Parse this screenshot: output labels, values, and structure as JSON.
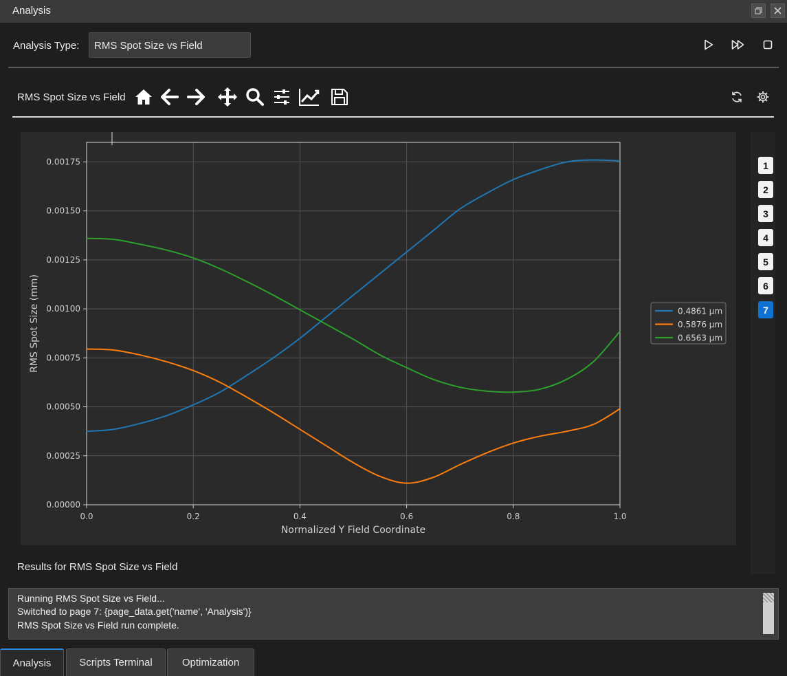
{
  "window": {
    "title": "Analysis"
  },
  "analysis_type": {
    "label": "Analysis Type:",
    "value": "RMS Spot Size vs Field"
  },
  "toolbar": {
    "plot_title": "RMS Spot Size vs Field",
    "icons": [
      "home-icon",
      "back-arrow-icon",
      "forward-arrow-icon",
      "pan-icon",
      "zoom-icon",
      "configure-subplots-icon",
      "edit-axes-icon",
      "save-icon"
    ],
    "right_icons": [
      "refresh-icon",
      "gear-icon"
    ]
  },
  "run_controls": [
    "play-icon",
    "fast-forward-icon",
    "stop-icon"
  ],
  "pages": {
    "items": [
      "1",
      "2",
      "3",
      "4",
      "5",
      "6",
      "7"
    ],
    "active": "7"
  },
  "results_label": "Results for RMS Spot Size vs Field",
  "console": {
    "lines": [
      "Running RMS Spot Size vs Field...",
      "Switched to page 7: {page_data.get('name', 'Analysis')}",
      "RMS Spot Size vs Field run complete."
    ]
  },
  "tabs": [
    {
      "label": "Analysis",
      "active": true
    },
    {
      "label": "Scripts Terminal",
      "active": false
    },
    {
      "label": "Optimization",
      "active": false
    }
  ],
  "chart_data": {
    "type": "line",
    "title": "",
    "xlabel": "Normalized Y Field Coordinate",
    "ylabel": "RMS Spot Size (mm)",
    "xlim": [
      0,
      1
    ],
    "ylim": [
      0,
      0.00185
    ],
    "xticks": [
      "0.0",
      "0.2",
      "0.4",
      "0.6",
      "0.8",
      "1.0"
    ],
    "yticks": [
      "0.00000",
      "0.00025",
      "0.00050",
      "0.00075",
      "0.00100",
      "0.00125",
      "0.00150",
      "0.00175"
    ],
    "grid": true,
    "legend_position": "center-right",
    "x": [
      0,
      0.05,
      0.1,
      0.15,
      0.2,
      0.25,
      0.3,
      0.35,
      0.4,
      0.45,
      0.5,
      0.55,
      0.6,
      0.65,
      0.7,
      0.75,
      0.8,
      0.85,
      0.9,
      0.95,
      1.0
    ],
    "series": [
      {
        "name": "0.4861 µm",
        "color": "#1f77b4",
        "values": [
          0.000375,
          0.000385,
          0.000415,
          0.000455,
          0.00051,
          0.000575,
          0.00066,
          0.00075,
          0.00085,
          0.00096,
          0.00107,
          0.00118,
          0.00129,
          0.0014,
          0.00151,
          0.00159,
          0.00166,
          0.00171,
          0.00175,
          0.00176,
          0.001755
        ]
      },
      {
        "name": "0.5876 µm",
        "color": "#ff7f0e",
        "values": [
          0.000795,
          0.00079,
          0.000765,
          0.00073,
          0.000685,
          0.000625,
          0.00055,
          0.00047,
          0.000385,
          0.0003,
          0.000215,
          0.000145,
          0.00011,
          0.00014,
          0.000205,
          0.000265,
          0.000315,
          0.00035,
          0.000375,
          0.00041,
          0.00049
        ]
      },
      {
        "name": "0.6563 µm",
        "color": "#2ca02c",
        "values": [
          0.00136,
          0.001355,
          0.00133,
          0.0013,
          0.00126,
          0.001205,
          0.00114,
          0.00107,
          0.000995,
          0.00092,
          0.000845,
          0.000765,
          0.0007,
          0.00064,
          0.0006,
          0.00058,
          0.000575,
          0.00059,
          0.00064,
          0.00073,
          0.000885
        ]
      }
    ]
  }
}
